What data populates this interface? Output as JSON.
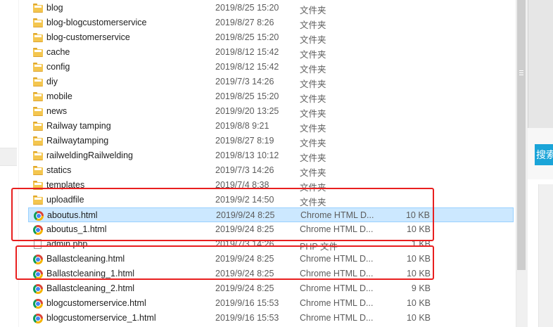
{
  "files": [
    {
      "name": "blog",
      "date": "2019/8/25 15:20",
      "type": "文件夹",
      "size": "",
      "icon": "folder-icon"
    },
    {
      "name": "blog-blogcustomerservice",
      "date": "2019/8/27 8:26",
      "type": "文件夹",
      "size": "",
      "icon": "folder-icon"
    },
    {
      "name": "blog-customerservice",
      "date": "2019/8/25 15:20",
      "type": "文件夹",
      "size": "",
      "icon": "folder-icon"
    },
    {
      "name": "cache",
      "date": "2019/8/12 15:42",
      "type": "文件夹",
      "size": "",
      "icon": "folder-icon"
    },
    {
      "name": "config",
      "date": "2019/8/12 15:42",
      "type": "文件夹",
      "size": "",
      "icon": "folder-icon"
    },
    {
      "name": "diy",
      "date": "2019/7/3 14:26",
      "type": "文件夹",
      "size": "",
      "icon": "folder-icon"
    },
    {
      "name": "mobile",
      "date": "2019/8/25 15:20",
      "type": "文件夹",
      "size": "",
      "icon": "folder-icon"
    },
    {
      "name": "news",
      "date": "2019/9/20 13:25",
      "type": "文件夹",
      "size": "",
      "icon": "folder-icon"
    },
    {
      "name": "Railway tamping",
      "date": "2019/8/8 9:21",
      "type": "文件夹",
      "size": "",
      "icon": "folder-icon"
    },
    {
      "name": "Railwaytamping",
      "date": "2019/8/27 8:19",
      "type": "文件夹",
      "size": "",
      "icon": "folder-icon"
    },
    {
      "name": "railweldingRailwelding",
      "date": "2019/8/13 10:12",
      "type": "文件夹",
      "size": "",
      "icon": "folder-icon"
    },
    {
      "name": "statics",
      "date": "2019/7/3 14:26",
      "type": "文件夹",
      "size": "",
      "icon": "folder-icon"
    },
    {
      "name": "templates",
      "date": "2019/7/4 8:38",
      "type": "文件夹",
      "size": "",
      "icon": "folder-icon"
    },
    {
      "name": "uploadfile",
      "date": "2019/9/2 14:50",
      "type": "文件夹",
      "size": "",
      "icon": "folder-icon"
    },
    {
      "name": "aboutus.html",
      "date": "2019/9/24 8:25",
      "type": "Chrome HTML D...",
      "size": "10 KB",
      "icon": "chrome-icon",
      "selected": true
    },
    {
      "name": "aboutus_1.html",
      "date": "2019/9/24 8:25",
      "type": "Chrome HTML D...",
      "size": "10 KB",
      "icon": "chrome-icon"
    },
    {
      "name": "admin.php",
      "date": "2019/7/3 14:26",
      "type": "PHP 文件",
      "size": "1 KB",
      "icon": "file-icon"
    },
    {
      "name": "Ballastcleaning.html",
      "date": "2019/9/24 8:25",
      "type": "Chrome HTML D...",
      "size": "10 KB",
      "icon": "chrome-icon"
    },
    {
      "name": "Ballastcleaning_1.html",
      "date": "2019/9/24 8:25",
      "type": "Chrome HTML D...",
      "size": "10 KB",
      "icon": "chrome-icon"
    },
    {
      "name": "Ballastcleaning_2.html",
      "date": "2019/9/24 8:25",
      "type": "Chrome HTML D...",
      "size": "9 KB",
      "icon": "chrome-icon"
    },
    {
      "name": "blogcustomerservice.html",
      "date": "2019/9/16 15:53",
      "type": "Chrome HTML D...",
      "size": "10 KB",
      "icon": "chrome-icon"
    },
    {
      "name": "blogcustomerservice_1.html",
      "date": "2019/9/16 15:53",
      "type": "Chrome HTML D...",
      "size": "10 KB",
      "icon": "chrome-icon"
    }
  ],
  "search_button_label": "搜索",
  "colors": {
    "selection_bg": "#cce8ff",
    "highlight_border": "#e81f1f",
    "folder": "#f4c64f",
    "search_button": "#1aa4d8"
  }
}
